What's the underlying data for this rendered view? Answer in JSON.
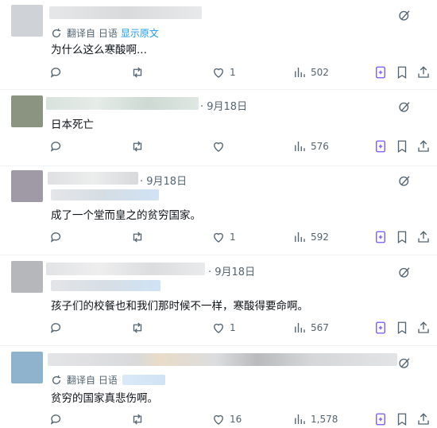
{
  "posts": [
    {
      "translate": {
        "prefix": "翻译自 日语",
        "show_original": "显示原文"
      },
      "text": "为什么这么寒酸啊...",
      "date": "",
      "replies": "",
      "retweets": "",
      "likes": "1",
      "views": "502",
      "avatar_color": "#c9ccd1"
    },
    {
      "translate": null,
      "text": "日本死亡",
      "date": "· 9月18日",
      "replies": "",
      "retweets": "",
      "likes": "",
      "views": "576",
      "avatar_color": "#8a9481"
    },
    {
      "translate": null,
      "text": "成了一个堂而皇之的贫穷国家。",
      "date": "· 9月18日",
      "replies": "",
      "retweets": "",
      "likes": "1",
      "views": "592",
      "avatar_color": "#9f9aa6"
    },
    {
      "translate": null,
      "text": "孩子们的校餐也和我们那时候不一样，寒酸得要命啊。",
      "date": "· 9月18日",
      "replies": "",
      "retweets": "",
      "likes": "1",
      "views": "567",
      "avatar_color": "#b5b7ba"
    },
    {
      "translate": {
        "prefix": "翻译自 日语",
        "show_original": ""
      },
      "text": "贫穷的国家真悲伤啊。",
      "date": "",
      "replies": "",
      "retweets": "",
      "likes": "16",
      "views": "1,578",
      "avatar_color": "#8fb3cc"
    }
  ],
  "colors": {
    "muted": "#536471",
    "link": "#1d9bf0",
    "grok": "#7856ff"
  },
  "icons": [
    "reply-icon",
    "retweet-icon",
    "like-icon",
    "views-icon",
    "grok-icon",
    "bookmark-icon",
    "share-icon",
    "more-icon",
    "translate-icon"
  ]
}
